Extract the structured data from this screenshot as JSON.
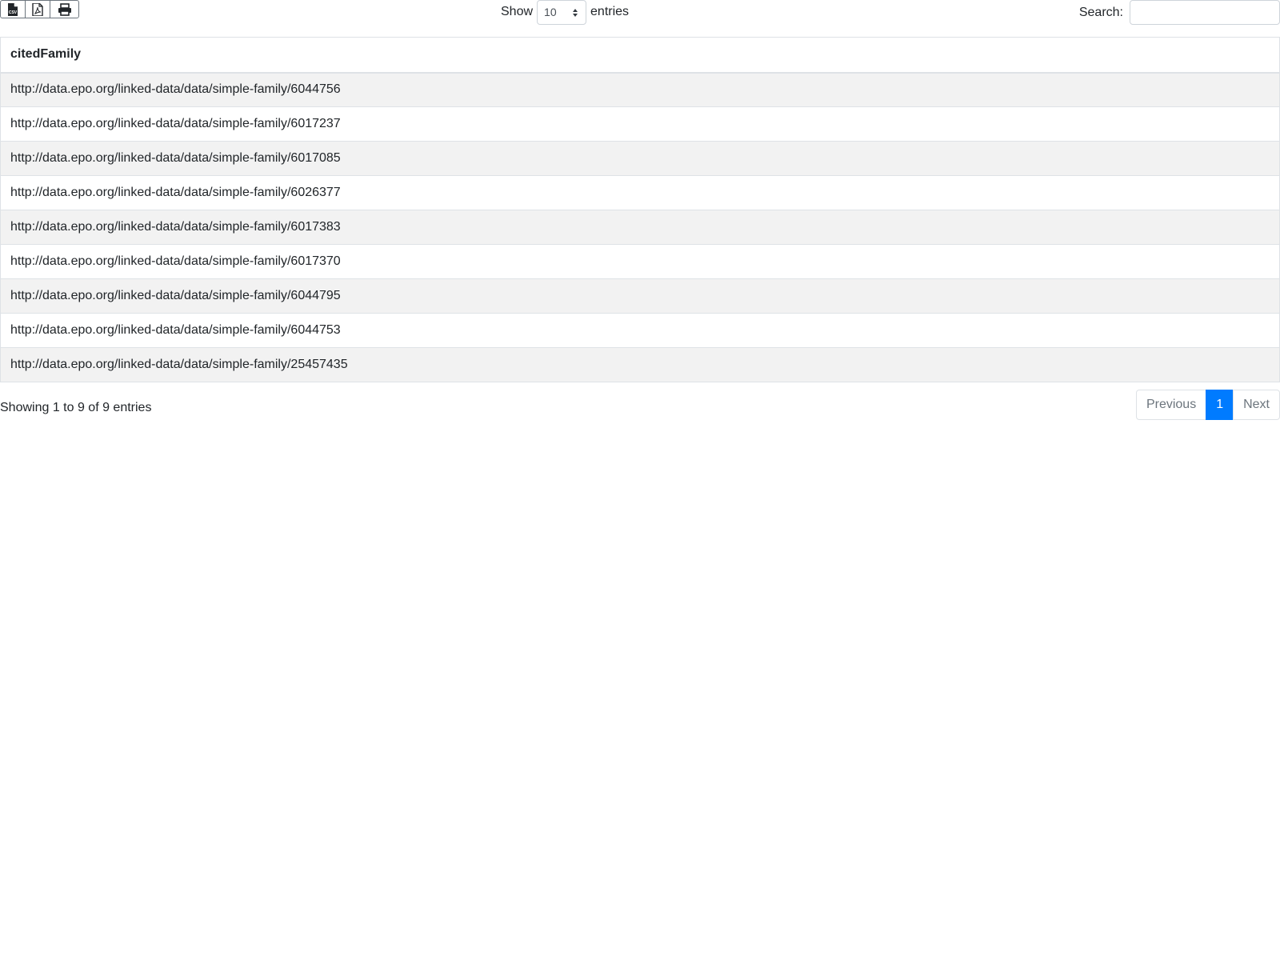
{
  "toolbar": {
    "buttons": [
      {
        "icon": "csv-file-icon",
        "label": "CSV"
      },
      {
        "icon": "pdf-file-icon"
      },
      {
        "icon": "print-icon"
      }
    ]
  },
  "length": {
    "show_label": "Show",
    "value": "10",
    "entries_label": "entries"
  },
  "search": {
    "label": "Search:",
    "value": "",
    "placeholder": ""
  },
  "table": {
    "columns": [
      "citedFamily"
    ],
    "rows": [
      "http://data.epo.org/linked-data/data/simple-family/6044756",
      "http://data.epo.org/linked-data/data/simple-family/6017237",
      "http://data.epo.org/linked-data/data/simple-family/6017085",
      "http://data.epo.org/linked-data/data/simple-family/6026377",
      "http://data.epo.org/linked-data/data/simple-family/6017383",
      "http://data.epo.org/linked-data/data/simple-family/6017370",
      "http://data.epo.org/linked-data/data/simple-family/6044795",
      "http://data.epo.org/linked-data/data/simple-family/6044753",
      "http://data.epo.org/linked-data/data/simple-family/25457435"
    ]
  },
  "info": "Showing 1 to 9 of 9 entries",
  "pagination": {
    "previous": "Previous",
    "page": "1",
    "next": "Next"
  },
  "colors": {
    "accent": "#007bff",
    "stripe": "#f2f2f2",
    "border": "#dee2e6"
  }
}
